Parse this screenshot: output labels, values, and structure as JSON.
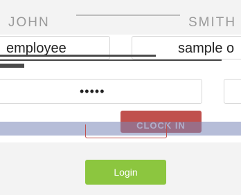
{
  "sections": {
    "left_label": "JOHN",
    "right_label": "SMITH"
  },
  "fields": {
    "employee_value": "employee",
    "sample_value": "sample o",
    "password_mask": "•••••"
  },
  "buttons": {
    "clock_in_label": "CLOCK IN",
    "login_label": "Login"
  },
  "colors": {
    "login_green": "#8cc63f",
    "clock_red": "#c0504d",
    "overlay_blue": "#7a86b8"
  }
}
